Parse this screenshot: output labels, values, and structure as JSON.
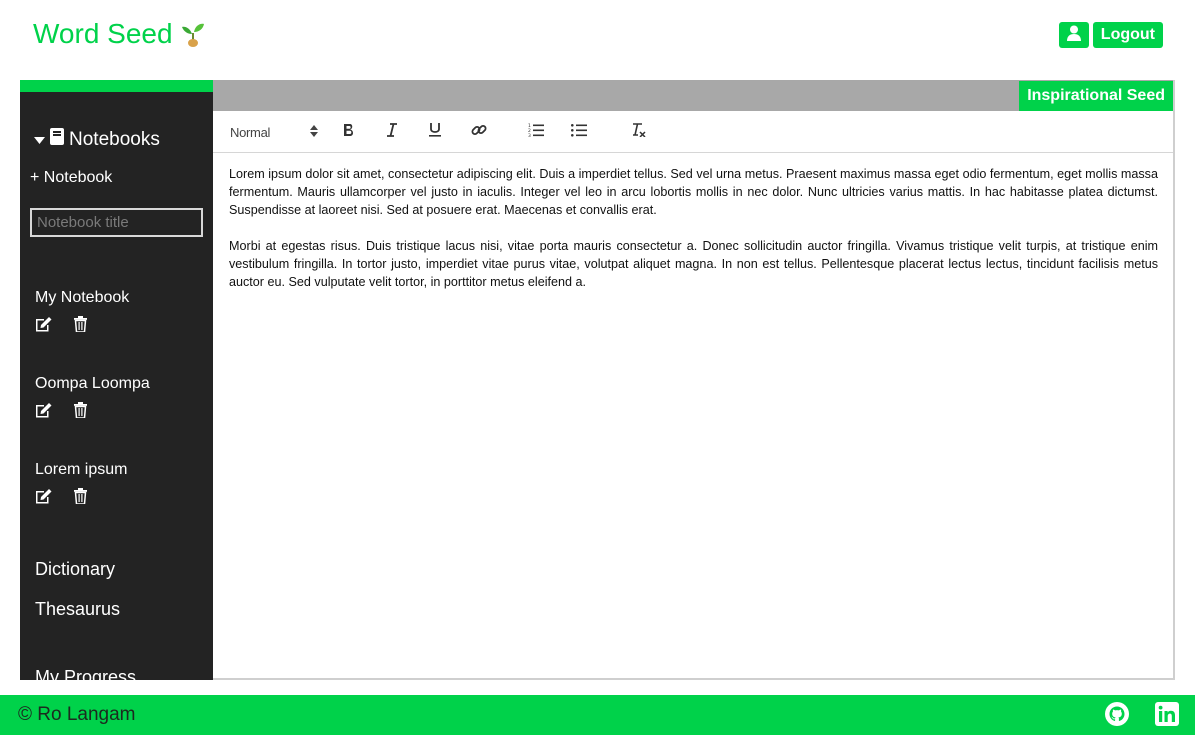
{
  "header": {
    "brand": "Word Seed",
    "logout_label": "Logout"
  },
  "sidebar": {
    "notebooks_heading": "Notebooks",
    "add_notebook_label": "+ Notebook",
    "notebook_title_placeholder": "Notebook title",
    "notebooks": [
      {
        "name": "My Notebook"
      },
      {
        "name": "Oompa Loompa"
      },
      {
        "name": "Lorem ipsum"
      }
    ],
    "links": {
      "dictionary": "Dictionary",
      "thesaurus": "Thesaurus",
      "progress": "My Progress"
    }
  },
  "main": {
    "inspirational_label": "Inspirational Seed",
    "toolbar": {
      "format_select": "Normal",
      "icons": [
        "bold-icon",
        "italic-icon",
        "underline-icon",
        "link-icon",
        "ordered-list-icon",
        "bullet-list-icon",
        "clear-format-icon"
      ]
    },
    "editor": {
      "paragraphs": [
        "Lorem ipsum dolor sit amet, consectetur adipiscing elit. Duis a imperdiet tellus. Sed vel urna metus. Praesent maximus massa eget odio fermentum, eget mollis massa fermentum. Mauris ullamcorper vel justo in iaculis. Integer vel leo in arcu lobortis mollis in nec dolor. Nunc ultricies varius mattis. In hac habitasse platea dictumst. Suspendisse at laoreet nisi. Sed at posuere erat. Maecenas et convallis erat.",
        "Morbi at egestas risus. Duis tristique lacus nisi, vitae porta mauris consectetur a. Donec sollicitudin auctor fringilla. Vivamus tristique velit turpis, at tristique enim vestibulum fringilla. In tortor justo, imperdiet vitae purus vitae, volutpat aliquet magna. In non est tellus. Pellentesque placerat lectus lectus, tincidunt facilisis metus auctor eu. Sed vulputate velit tortor, in porttitor metus eleifend a."
      ]
    }
  },
  "footer": {
    "copyright": "© Ro Langam"
  },
  "colors": {
    "accent": "#00d24a",
    "sidebar_bg": "#232323",
    "topbar_gray": "#a8a8a8"
  }
}
